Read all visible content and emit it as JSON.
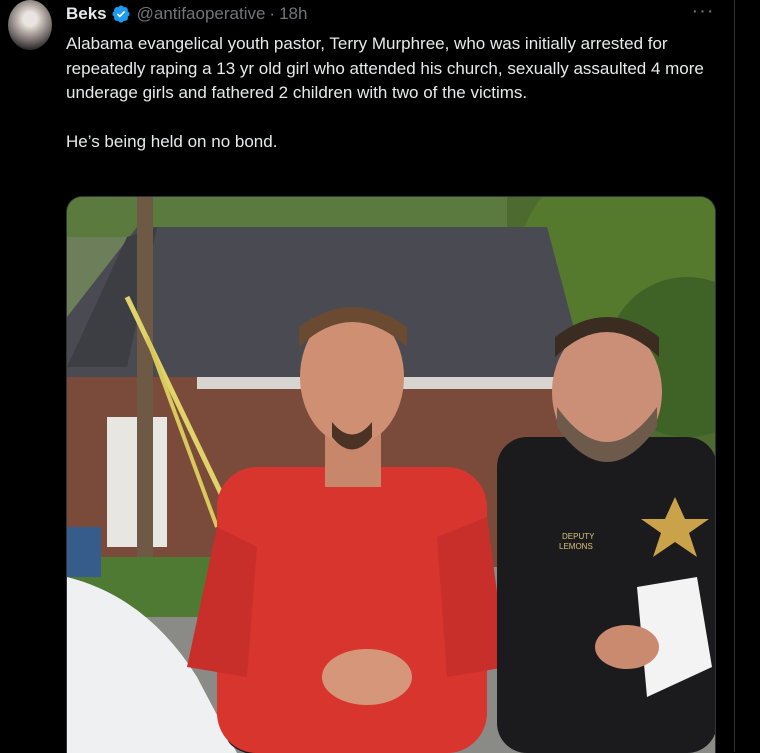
{
  "tweet": {
    "author_name": "Beks",
    "handle": "@antifaoperative",
    "separator": "·",
    "time": "18h",
    "more_icon": "more-icon",
    "verified_icon": "verified-badge-icon",
    "text": "Alabama evangelical youth pastor, Terry Murphree, who was initially arrested for repeatedly raping a 13 yr old girl who attended his church, sexually assaulted 4 more underage girls and fathered 2 children with two of the victims.\n\nHe’s being held on no bond.",
    "media": {
      "badge_text_line1": "DEPUTY",
      "badge_text_line2": "LEMONS"
    }
  },
  "colors": {
    "background": "#000000",
    "text": "#e7e9ea",
    "secondary": "#71767b",
    "verified": "#1d9bf0",
    "border": "#2f3336"
  }
}
